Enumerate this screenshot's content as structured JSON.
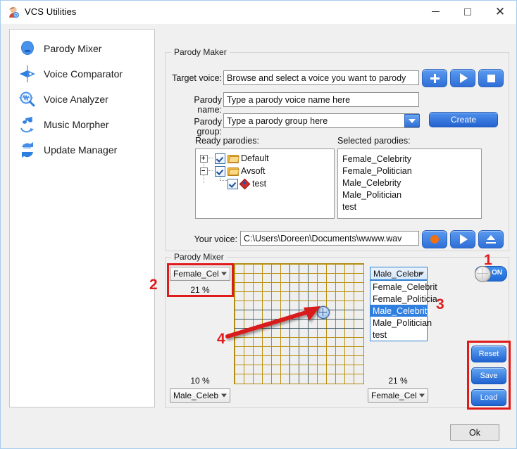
{
  "window": {
    "title": "VCS Utilities",
    "icon": "app-face-icon",
    "minimize": "–",
    "maximize": "□",
    "close": "✕"
  },
  "sidebar": {
    "items": [
      {
        "label": "Parody Mixer",
        "icon": "parody-mixer-icon"
      },
      {
        "label": "Voice Comparator",
        "icon": "voice-comparator-icon"
      },
      {
        "label": "Voice Analyzer",
        "icon": "voice-analyzer-icon"
      },
      {
        "label": "Music Morpher",
        "icon": "music-morpher-icon"
      },
      {
        "label": "Update Manager",
        "icon": "update-manager-icon"
      }
    ]
  },
  "parody_maker": {
    "caption": "Parody Maker",
    "target_voice_label": "Target voice:",
    "target_voice_value": "Browse and select a voice you want to parody",
    "parody_name_label": "Parody name:",
    "parody_name_value": "Type a parody voice name here",
    "parody_group_label": "Parody group:",
    "parody_group_value": "Type a parody group here",
    "create_label": "Create",
    "buttons": {
      "add": "add-icon",
      "play": "play-icon",
      "stop": "stop-icon"
    },
    "ready_label": "Ready parodies:",
    "selected_label": "Selected parodies:",
    "tree": [
      {
        "label": "Default",
        "expander": "plus",
        "checked": true,
        "icon": "folder-icon",
        "depth": 0
      },
      {
        "label": "Avsoft",
        "expander": "minus",
        "checked": true,
        "icon": "folder-icon",
        "depth": 0
      },
      {
        "label": "test",
        "expander": "none",
        "checked": true,
        "icon": "diamond-icon",
        "depth": 1
      }
    ],
    "selected_parodies": [
      "Female_Celebrity",
      "Female_Politician",
      "Male_Celebrity",
      "Male_Politician",
      "test"
    ],
    "your_voice_label": "Your voice:",
    "your_voice_value": "C:\\Users\\Doreen\\Documents\\wwww.wav",
    "voice_buttons": {
      "record": "record-icon",
      "play": "play-icon",
      "eject": "eject-icon"
    }
  },
  "parody_mixer": {
    "caption": "Parody Mixer",
    "top_left": {
      "voice": "Female_Cel",
      "percent": "21 %"
    },
    "bottom_left": {
      "voice": "Male_Celeb",
      "percent": "10 %"
    },
    "bottom_right": {
      "voice": "Female_Cel",
      "percent": "21 %"
    },
    "top_right": {
      "selected": "Male_Celebr",
      "options": [
        "Female_Celebrit",
        "Female_Politicia",
        "Male_Celebrity",
        "Male_Politician",
        "test"
      ],
      "selected_index": 2
    },
    "toggle": {
      "label": "ON",
      "state": "on"
    },
    "actions": [
      "Reset",
      "Save",
      "Load"
    ]
  },
  "footer": {
    "ok_label": "Ok"
  },
  "annotations": {
    "markers": [
      "1",
      "2",
      "3",
      "4"
    ],
    "color": "#e01b1b"
  }
}
